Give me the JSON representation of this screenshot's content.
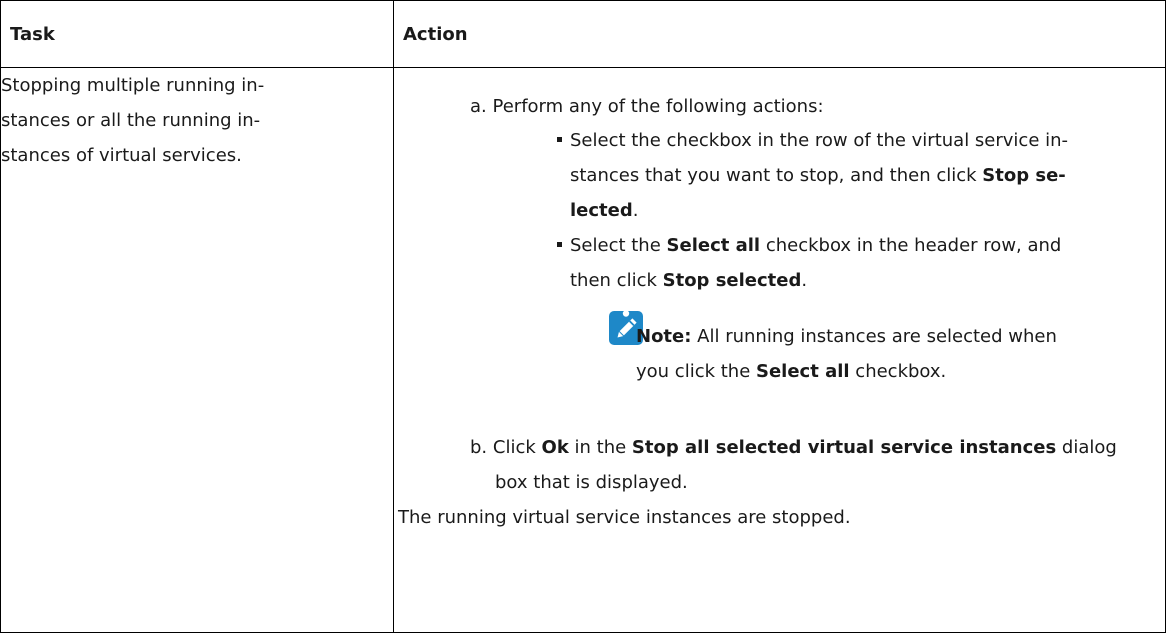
{
  "header": {
    "task": "Task",
    "action": "Action"
  },
  "task": {
    "line1": "Stopping multiple running in-",
    "line2": "stances or all the running in-",
    "line3": "stances of virtual services."
  },
  "action": {
    "step_a_marker": "a.",
    "step_a_text": "Perform any of the following actions:",
    "bullet1": {
      "line1": "Select the checkbox in the row of the virtual service in-",
      "line2_pre": "stances that you want to stop, and then click ",
      "line2_bold": "Stop se-",
      "line3_bold": "lected",
      "line3_post": "."
    },
    "bullet2": {
      "line1_pre": "Select the ",
      "line1_bold": "Select all",
      "line1_post": " checkbox in the header row, and",
      "line2_pre": "then click ",
      "line2_bold": "Stop selected",
      "line2_post": "."
    },
    "note": {
      "label": "Note:",
      "line1_post": " All running instances are selected when",
      "line2_pre": "you click the ",
      "line2_bold": "Select all",
      "line2_post": " checkbox."
    },
    "step_b_marker": "b.",
    "step_b": {
      "line1_pre": "Click ",
      "line1_bold1": "Ok",
      "line1_mid": " in the ",
      "line1_bold2": "Stop all selected virtual service instances",
      "line1_post": " dialog",
      "line2": "box that is displayed."
    },
    "result": "The running virtual service instances are stopped."
  },
  "icons": {
    "note": "note-pencil-icon"
  },
  "colors": {
    "note_icon_bg": "#1e88c8"
  }
}
